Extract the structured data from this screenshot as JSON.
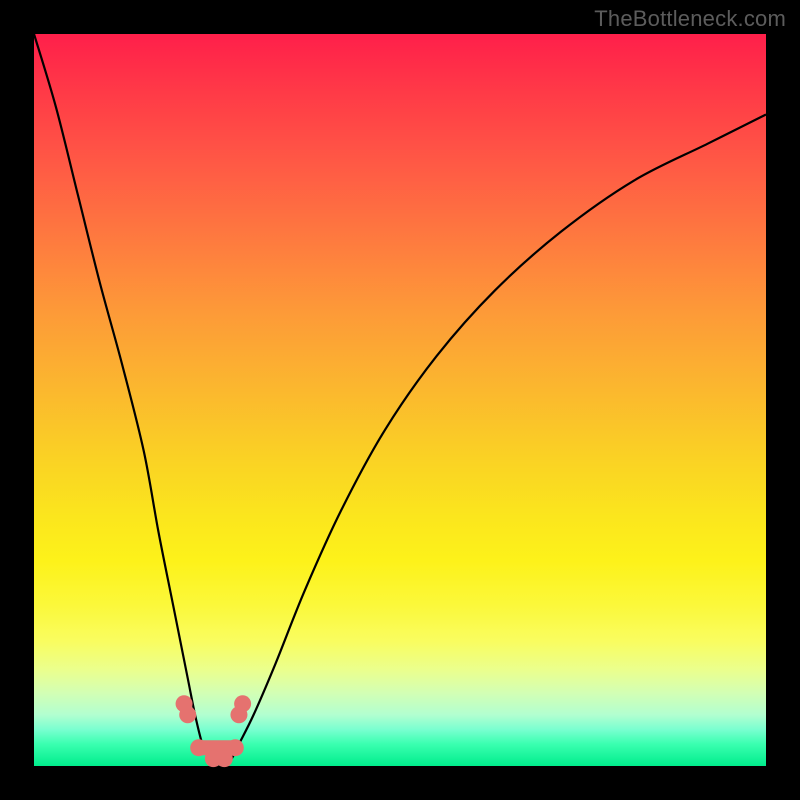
{
  "watermark": "TheBottleneck.com",
  "chart_data": {
    "type": "line",
    "title": "",
    "xlabel": "",
    "ylabel": "",
    "xlim": [
      0,
      100
    ],
    "ylim": [
      0,
      100
    ],
    "grid": false,
    "series": [
      {
        "name": "curve",
        "x": [
          0,
          3,
          6,
          9,
          12,
          15,
          17,
          19,
          21,
          22,
          23,
          24,
          25,
          26,
          27,
          28,
          30,
          33,
          37,
          42,
          48,
          55,
          63,
          72,
          82,
          92,
          100
        ],
        "values": [
          100,
          90,
          78,
          66,
          55,
          43,
          32,
          22,
          12,
          7,
          3,
          1,
          0,
          0,
          1,
          3,
          7,
          14,
          24,
          35,
          46,
          56,
          65,
          73,
          80,
          85,
          89
        ]
      },
      {
        "name": "markers",
        "x": [
          20.5,
          21.0,
          22.5,
          24.5,
          26.0,
          27.5,
          28.0,
          28.5
        ],
        "values": [
          8.5,
          7.0,
          2.5,
          1.0,
          1.0,
          2.5,
          7.0,
          8.5
        ]
      }
    ],
    "colors": {
      "curve": "#000000",
      "markers": "#e5726f",
      "gradient_top": "#ff1f4a",
      "gradient_bottom": "#00ed8c"
    }
  }
}
